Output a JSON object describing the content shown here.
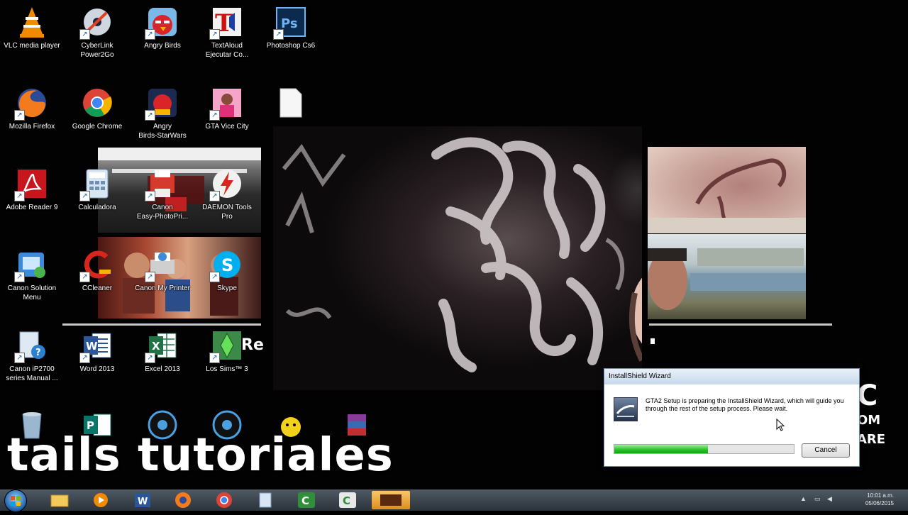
{
  "desktop": {
    "icons": [
      {
        "label": "VLC media player",
        "icon": "vlc-icon"
      },
      {
        "label": "CyberLink\nPower2Go",
        "icon": "power2go-icon"
      },
      {
        "label": "Angry Birds",
        "icon": "angry-birds-icon"
      },
      {
        "label": "TextAloud\nEjecutar Co...",
        "icon": "textaloud-icon"
      },
      {
        "label": "Photoshop Cs6",
        "icon": "photoshop-icon"
      },
      {
        "label": "Mozilla Firefox",
        "icon": "firefox-icon"
      },
      {
        "label": "Google Chrome",
        "icon": "chrome-icon"
      },
      {
        "label": "Angry\nBirds-StarWars",
        "icon": "angry-birds-starwars-icon"
      },
      {
        "label": "GTA Vice City",
        "icon": "gta-vice-city-icon"
      },
      {
        "label": "",
        "icon": "blank-file-icon"
      },
      {
        "label": "Adobe Reader 9",
        "icon": "adobe-reader-icon"
      },
      {
        "label": "Calculadora",
        "icon": "calculator-icon"
      },
      {
        "label": "Canon\nEasy-PhotoPri...",
        "icon": "canon-photoprint-icon"
      },
      {
        "label": "DAEMON Tools\nPro",
        "icon": "daemon-tools-icon"
      },
      {
        "label": "Canon Solution\nMenu",
        "icon": "canon-solution-icon"
      },
      {
        "label": "CCleaner",
        "icon": "ccleaner-icon"
      },
      {
        "label": "Canon My Printer",
        "icon": "canon-printer-icon"
      },
      {
        "label": "Skype",
        "icon": "skype-icon"
      },
      {
        "label": "Canon iP2700\nseries Manual ...",
        "icon": "canon-manual-icon"
      },
      {
        "label": "Word 2013",
        "icon": "word-icon"
      },
      {
        "label": "Excel 2013",
        "icon": "excel-icon"
      },
      {
        "label": "Los Sims™ 3",
        "icon": "sims-icon"
      },
      {
        "label": "",
        "icon": "recycle-bin-icon"
      },
      {
        "label": "",
        "icon": "publisher-icon"
      },
      {
        "label": "",
        "icon": "webcam-icon"
      },
      {
        "label": "",
        "icon": "webcam-icon-2"
      },
      {
        "label": "",
        "icon": "emoji-icon"
      },
      {
        "label": "",
        "icon": "winrar-icon"
      }
    ]
  },
  "watermark": "tails tutoriales",
  "brand_partial": [
    "C",
    "OM",
    "ARE"
  ],
  "dialog": {
    "title": "InstallShield Wizard",
    "message": "GTA2 Setup is preparing the InstallShield Wizard, which will guide you through the rest of the setup process. Please wait.",
    "progress": 0.52,
    "cancel_label": "Cancel"
  },
  "taskbar": {
    "apps": [
      "explorer-icon",
      "media-player-icon",
      "word-icon",
      "firefox-icon",
      "chrome-icon",
      "calculator-icon",
      "camtasia-icon",
      "camtasia-icon-2",
      "gta2-setup-icon"
    ],
    "time": "10:01 a.m.",
    "date": "05/06/2015"
  },
  "colors": {
    "accent_green": "#23c323",
    "dialog_border": "#6a8bb1",
    "taskbar": "#2b333b"
  }
}
